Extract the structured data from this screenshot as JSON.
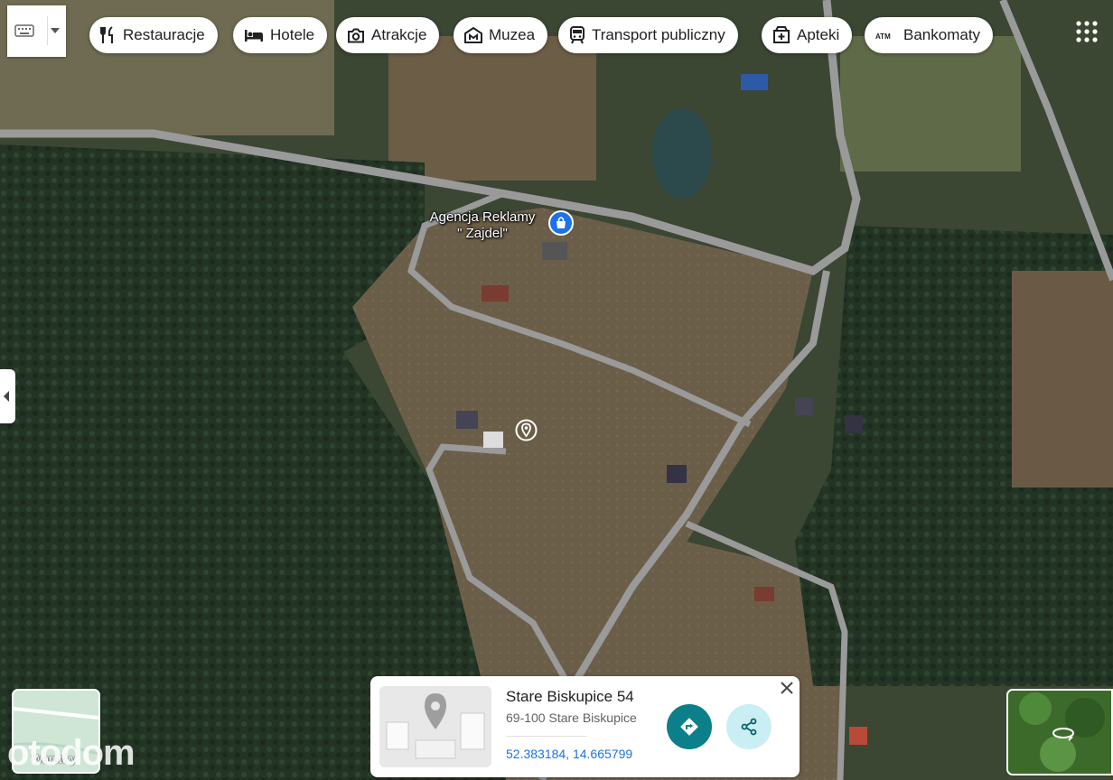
{
  "toolbar": {
    "keyboard_icon": "keyboard-icon",
    "dropdown_icon": "caret-down-icon"
  },
  "categories": [
    {
      "label": "Restauracje",
      "icon": "fork-knife-icon"
    },
    {
      "label": "Hotele",
      "icon": "bed-icon"
    },
    {
      "label": "Atrakcje",
      "icon": "camera-icon"
    },
    {
      "label": "Muzea",
      "icon": "museum-icon"
    },
    {
      "label": "Transport publiczny",
      "icon": "train-icon"
    },
    {
      "label": "Apteki",
      "icon": "pharmacy-icon"
    },
    {
      "label": "Bankomaty",
      "icon": "atm-icon"
    }
  ],
  "map": {
    "poi_label": "Agencja Reklamy\n\" Zajdel\"",
    "poi_icon": "shopping-bag-pin-icon",
    "selected_pin_icon": "location-pin-icon"
  },
  "place_card": {
    "title": "Stare Biskupice 54",
    "address": "69-100 Stare Biskupice",
    "coordinates": "52.383184, 14.665799",
    "directions_icon": "directions-icon",
    "share_icon": "share-icon",
    "close_icon": "close-icon"
  },
  "layers": {
    "label": "Warstwy"
  },
  "watermark": "otodom",
  "colors": {
    "directions_button": "#0b7f8a",
    "share_button": "#c9eef3",
    "poi_pin": "#1a73e8",
    "road": "#9a9a9a"
  }
}
